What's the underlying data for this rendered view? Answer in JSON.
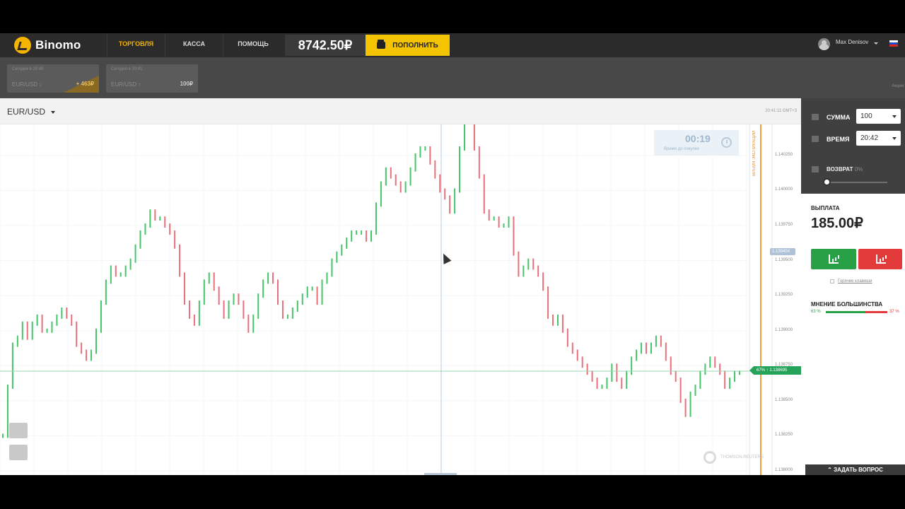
{
  "brand": {
    "name": "Binomo",
    "accent": "#f5b400"
  },
  "nav": [
    {
      "label": "ТОРГОВЛЯ",
      "active": true
    },
    {
      "label": "КАССА",
      "active": false
    },
    {
      "label": "ПОМОЩЬ",
      "active": false
    }
  ],
  "account": {
    "balance": "8742.50₽",
    "deposit_label": "ПОПОЛНИТЬ",
    "user_name": "Max Denisov"
  },
  "deals": [
    {
      "title": "Сегодня в 20:40",
      "pair": "EUR/USD ↓",
      "value": "+ 463₽"
    },
    {
      "title": "Сегодня в 20:41",
      "pair": "EUR/USD ↑",
      "value": "100₽"
    }
  ],
  "subbar_right": "Акции",
  "chart_header": {
    "pair": "EUR/USD",
    "server_time": "20:41:11 GMT+3"
  },
  "timer": {
    "value": "00:19",
    "label": "Время до покупки"
  },
  "expiry_label": "ВРЕМЯ ЭКСПИРАЦИИ",
  "current_price": {
    "label": "67% ↑ 1.138695",
    "cursor_price": "1.139404"
  },
  "watermark": "THOMSON REUTERS",
  "panel": {
    "amount_label": "СУММА",
    "amount_value": "100",
    "time_label": "ВРЕМЯ",
    "time_value": "20:42",
    "refund_label": "ВОЗВРАТ",
    "refund_pct": "0%",
    "payout_label": "ВЫПЛАТА",
    "payout_value": "185.00₽",
    "hotkeys_label": "Горячие клавиши",
    "majority_label": "МНЕНИЕ БОЛЬШИНСТВА",
    "majority_up": "63 %",
    "majority_down": "37 %",
    "majority_up_fraction": 0.63,
    "ask_label": "ЗАДАТЬ ВОПРОС"
  },
  "chart_data": {
    "type": "line",
    "y_ticks": [
      "1.140250",
      "1.140000",
      "1.139750",
      "1.139500",
      "1.139250",
      "1.139000",
      "1.138750",
      "1.138500",
      "1.138250",
      "1.138000"
    ],
    "ylim": [
      1.138,
      1.1403
    ],
    "series": [
      {
        "values": [
          1.13825,
          1.1386,
          1.1389,
          1.13895,
          1.13905,
          1.13895,
          1.13905,
          1.1391,
          1.139,
          1.139,
          1.13905,
          1.1391,
          1.13915,
          1.1391,
          1.13905,
          1.1389,
          1.13885,
          1.1388,
          1.13885,
          1.139,
          1.1392,
          1.13935,
          1.13945,
          1.1394,
          1.1394,
          1.13945,
          1.1395,
          1.1396,
          1.1397,
          1.13975,
          1.13985,
          1.1398,
          1.1398,
          1.13975,
          1.1397,
          1.1396,
          1.1394,
          1.1392,
          1.1391,
          1.13905,
          1.1392,
          1.13935,
          1.1394,
          1.1393,
          1.1392,
          1.1391,
          1.1392,
          1.13925,
          1.1392,
          1.1391,
          1.139,
          1.1391,
          1.13925,
          1.13935,
          1.1394,
          1.13935,
          1.1392,
          1.1391,
          1.1391,
          1.13915,
          1.1392,
          1.13925,
          1.1393,
          1.1393,
          1.1392,
          1.13935,
          1.1394,
          1.1395,
          1.13955,
          1.1396,
          1.13965,
          1.1397,
          1.1397,
          1.1397,
          1.13965,
          1.1397,
          1.1399,
          1.14005,
          1.14015,
          1.1401,
          1.14005,
          1.14,
          1.14005,
          1.14015,
          1.14025,
          1.1403,
          1.1403,
          1.1402,
          1.1401,
          1.14,
          1.13995,
          1.13985,
          1.14,
          1.1403,
          1.1405,
          1.1405,
          1.1403,
          1.1401,
          1.13985,
          1.1398,
          1.1398,
          1.13975,
          1.13975,
          1.1398,
          1.13955,
          1.1394,
          1.13945,
          1.1395,
          1.13945,
          1.1394,
          1.1393,
          1.1391,
          1.13905,
          1.1391,
          1.139,
          1.1389,
          1.13885,
          1.1388,
          1.13875,
          1.1387,
          1.13865,
          1.1386,
          1.1386,
          1.13865,
          1.13875,
          1.13865,
          1.1386,
          1.1387,
          1.1388,
          1.13885,
          1.1389,
          1.13885,
          1.1389,
          1.13895,
          1.1389,
          1.1388,
          1.1387,
          1.13865,
          1.1385,
          1.1384,
          1.13855,
          1.1386,
          1.1387,
          1.13875,
          1.1388,
          1.13875,
          1.1387,
          1.1386,
          1.13865,
          1.1387,
          1.1387
        ]
      }
    ]
  }
}
